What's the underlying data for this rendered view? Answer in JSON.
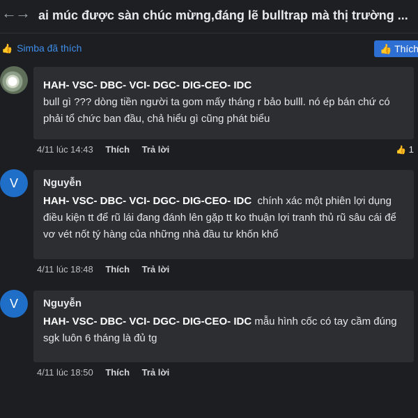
{
  "topbar": {
    "back_glyph": "←",
    "forward_glyph": "→",
    "title": "ai múc được sàn chúc mừng,đáng lẽ bulltrap mà thị trường ..."
  },
  "likes": {
    "text": "Simba đã thích",
    "button_label": "Thích"
  },
  "comments": [
    {
      "avatar_letter": "",
      "author": "",
      "tag": "HAH- VSC- DBC- VCI- DGC- DIG-CEO- IDC",
      "text": "bull gì ??? dòng tiền người ta gom mấy tháng r bảo bulll. nó ép bán chứ có phải tổ chức ban đầu, chả hiểu gì cũng phát biểu",
      "time": "4/11 lúc 14:43",
      "like_label": "Thích",
      "reply_label": "Trả lời",
      "reaction_count": "1"
    },
    {
      "avatar_letter": "V",
      "author": "Nguyễn",
      "tag": "HAH- VSC- DBC- VCI- DGC- DIG-CEO- IDC",
      "text": "chính xác một phiên lợi dụng điều kiện tt để rũ lái đang đánh lên gặp tt ko thuận lợi tranh thủ rũ sâu cái để vơ vét nốt tý hàng của những nhà đầu tư khốn khổ",
      "time": "4/11 lúc 18:48",
      "like_label": "Thích",
      "reply_label": "Trả lời"
    },
    {
      "avatar_letter": "V",
      "author": "Nguyễn",
      "tag": "HAH- VSC- DBC- VCI- DGC- DIG-CEO- IDC",
      "text": "mẫu hình cốc có tay cầm đúng sgk luôn 6 tháng là đủ tg",
      "time": "4/11 lúc 18:50",
      "like_label": "Thích",
      "reply_label": "Trả lời"
    }
  ],
  "colors": {
    "background": "#1c1e22",
    "bubble": "#2c2e32",
    "accent_blue": "#2d6fd3",
    "link_blue": "#3f8de8",
    "avatar_blue": "#1f6fc8"
  },
  "icons": {
    "back": "arrow-left-icon",
    "forward": "arrow-right-icon",
    "thumbs_up": "thumbs-up-icon"
  }
}
